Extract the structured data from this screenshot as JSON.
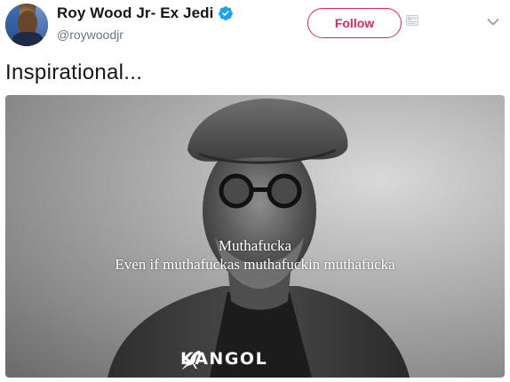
{
  "header": {
    "display_name": "Roy Wood Jr- Ex Jedi",
    "handle": "@roywoodjr",
    "follow_label": "Follow"
  },
  "tweet": {
    "text": "Inspirational..."
  },
  "media": {
    "caption_line1": "Muthafucka",
    "caption_line2": "Even if muthafuckas muthafuckin muthafucka",
    "brand": "KANGOL"
  },
  "colors": {
    "follow_accent": "#e0245e",
    "verified_blue": "#1da1f2",
    "name_text": "#14171a",
    "handle_text": "#657786"
  },
  "icons": {
    "verified": "verified-badge-icon",
    "card": "card-icon",
    "caret": "chevron-down-icon",
    "brand_logo": "kangaroo-icon"
  }
}
